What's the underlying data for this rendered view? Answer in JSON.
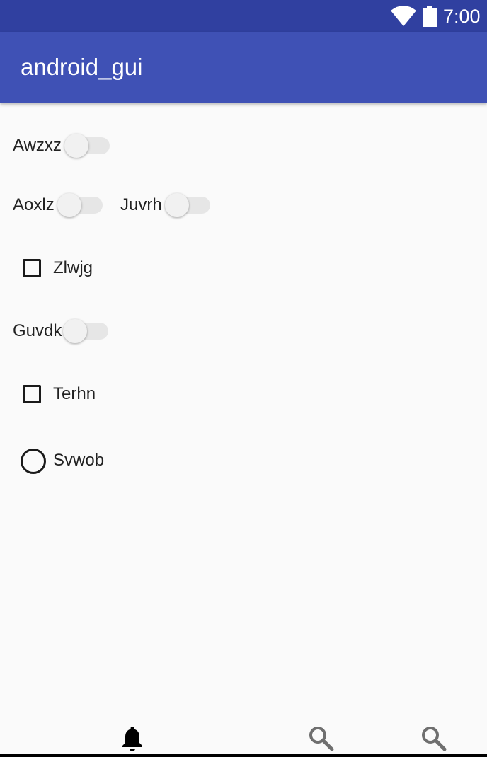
{
  "status_bar": {
    "time": "7:00",
    "icons": [
      "wifi-icon",
      "battery-icon"
    ]
  },
  "app_bar": {
    "title": "android_gui"
  },
  "form": {
    "switch_awzxz": {
      "label": "Awzxz",
      "checked": false
    },
    "switch_aoxlz": {
      "label": "Aoxlz",
      "checked": false
    },
    "switch_juvrh": {
      "label": "Juvrh",
      "checked": false
    },
    "checkbox_zlwjg": {
      "label": "Zlwjg",
      "checked": false
    },
    "switch_guvdk": {
      "label": "Guvdk",
      "checked": false
    },
    "checkbox_terhn": {
      "label": "Terhn",
      "checked": false
    },
    "radio_svwob": {
      "label": "Svwob",
      "checked": false
    }
  },
  "bottom_nav": {
    "items": [
      {
        "icon": "bell-icon",
        "active": true
      },
      {
        "icon": "search-icon",
        "active": false
      },
      {
        "icon": "search-icon",
        "active": false
      }
    ]
  },
  "colors": {
    "status_bar": "#3040a0",
    "app_bar": "#3f51b5",
    "background": "#fafafa"
  }
}
